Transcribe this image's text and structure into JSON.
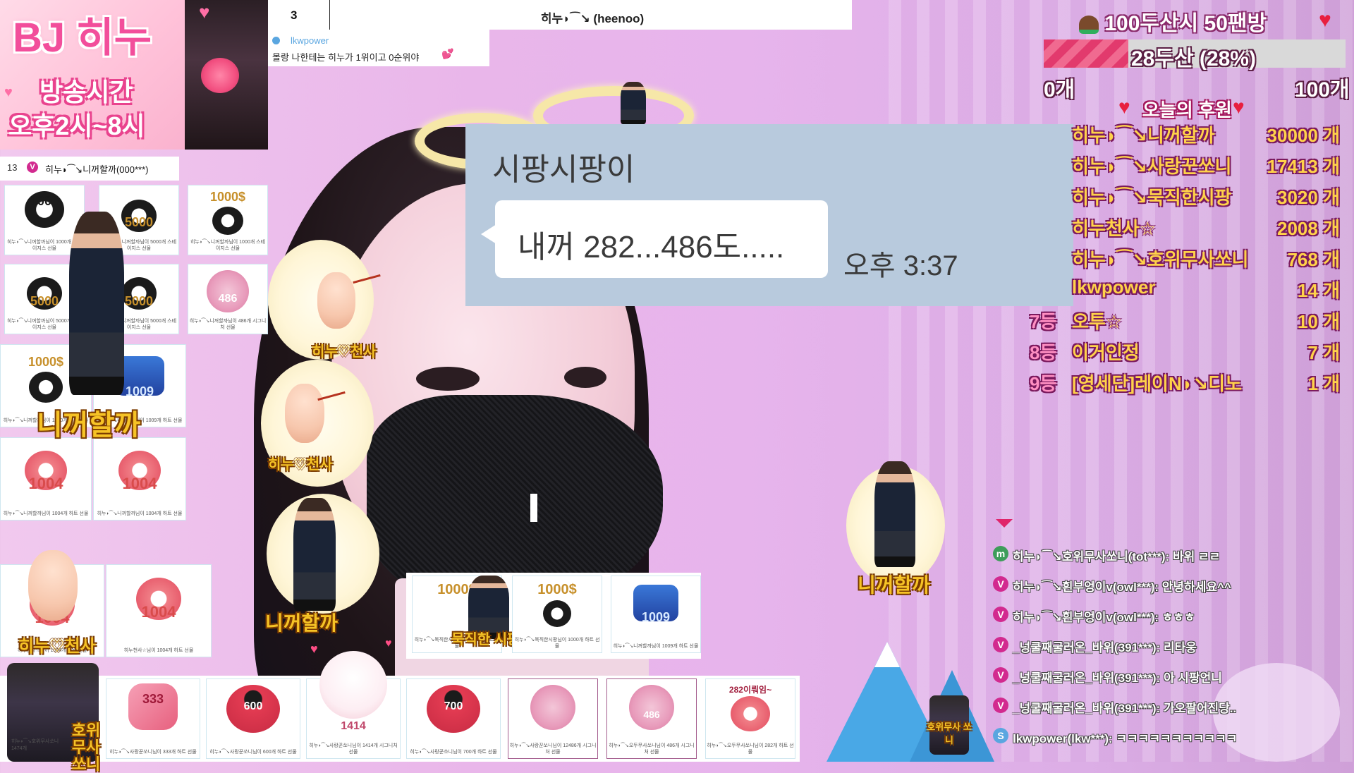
{
  "banner": {
    "title": "BJ 히누",
    "line1": "방송시간",
    "line2": "오후2시~8시"
  },
  "header": {
    "rank": "3",
    "title": "히누◗⁀↘ (heenoo)"
  },
  "chat_note": {
    "user": "lkwpower",
    "message": "몰랑 나한테는 히누가 1위이고 0순위야"
  },
  "donation_list": {
    "rank": "13",
    "badge": "V",
    "user": "히누◗⁀↘니꺼할까(000***)"
  },
  "cards": {
    "c1": {
      "num": "1000",
      "label": "히누◗⁀↘니꺼할까님이 1000개 스테이지스 선물"
    },
    "c2": {
      "num": "5000",
      "label": "히누◗⁀↘니꺼할까님이 5000개 스테이지스 선물"
    },
    "c3": {
      "num": "1000$",
      "label": "히누◗⁀↘니꺼할까님이 1000개 스테이지스 선물"
    },
    "c4": {
      "num": "5000",
      "label": "히누◗⁀↘니꺼할까님이 5000개 스테이지스 선물"
    },
    "c5": {
      "num": "5000",
      "label": "히누◗⁀↘니꺼할까님이 5000개 스테이지스 선물"
    },
    "c6": {
      "num": "486",
      "label": "히누◗⁀↘니꺼할까님이 486개 시그니처 선물"
    },
    "c7": {
      "num": "1000$",
      "label": "히누◗⁀↘니꺼할까님이 1000개 하트 선물"
    },
    "c8": {
      "num": "1009",
      "label": "히누◗⁀↘니꺼할까님이 1009개 하트 선물"
    },
    "c9": {
      "num": "1004",
      "label": "히누◗⁀↘니꺼할까님이 1004개 하트 선물"
    },
    "c10": {
      "num": "1004",
      "label": "히누◗⁀↘니꺼할까님이 1004개 하트 선물"
    },
    "c11": {
      "num": "1004",
      "label": "히누천사☆님이 1004개 하트 선물"
    },
    "c12": {
      "num": "1004",
      "label": "히누천사☆님이 1004개 하트 선물"
    },
    "m1": {
      "num": "1000$",
      "label": "히누◗⁀↘목직한시팡님이 1000개 하트 선물"
    },
    "m2": {
      "num": "1000$",
      "label": "히누◗⁀↘목직한시팡님이 1000개 하트 선물"
    },
    "m3": {
      "num": "1009",
      "label": "히누◗⁀↘니꺼할까님이 1009개 하트 선물"
    },
    "b1": {
      "num": "1474",
      "label": "히누◗⁀↘호위무사쏘니 1474개"
    },
    "b2": {
      "num": "333",
      "label": "히누◗⁀↘사랑꾼쏘니님이 333개 하트 선물"
    },
    "b3": {
      "num": "600",
      "label": "히누◗⁀↘사랑꾼쏘니님이 600개 하트 선물"
    },
    "b4": {
      "num": "1414",
      "label": "히누◗⁀↘사랑꾼쏘니님이 1414개 시그니처 선물"
    },
    "b5": {
      "num": "700",
      "label": "히누◗⁀↘사랑꾼쏘니님이 700개 하트 선물"
    },
    "b6": {
      "num": "12486",
      "label": "히누◗⁀↘사랑꾼쏘니님이 12486개 시그니처 선물"
    },
    "b7": {
      "num": "486",
      "label": "히누◗⁀↘오두무사쏘니님이 486개 시그니처 선물"
    },
    "b8": {
      "num": "282",
      "label": "히누◗⁀↘오두무사쏘니님이 282개 하트 선물"
    }
  },
  "sticker_labels": {
    "nikkeo": "니꺼할까",
    "angel": "히누♡천사",
    "guard": "호위무사 쏘니",
    "buddy": "282이뤄임~"
  },
  "popup": {
    "sender": "시팡시팡이",
    "message": "내꺼 282...486도.....",
    "time": "오후 3:37"
  },
  "goal": {
    "title": "100두산시 50팬방",
    "progress_text": "28두산 (28%)",
    "progress_fraction": 0.28,
    "min": "0개",
    "max": "100개",
    "accent": "#e23a6d"
  },
  "ranking": {
    "title": "오늘의 후원",
    "rows": [
      {
        "pos": "",
        "name": "히누◗⁀↘니꺼할까",
        "count": "30000 개"
      },
      {
        "pos": "",
        "name": "히누◗⁀↘사랑꾼쏘니",
        "count": "17413 개"
      },
      {
        "pos": "",
        "name": "히누◗⁀↘묵직한시팡",
        "count": "3020 개"
      },
      {
        "pos": "",
        "name": "히누천사☆",
        "count": "2008 개"
      },
      {
        "pos": "",
        "name": "히누◗⁀↘호위무사쏘니",
        "count": "768 개"
      },
      {
        "pos": "",
        "name": "lkwpower",
        "count": "14 개"
      },
      {
        "pos": "7등",
        "name": "오투☆",
        "count": "10 개"
      },
      {
        "pos": "8등",
        "name": "이거인정",
        "count": "7 개"
      },
      {
        "pos": "9등",
        "name": "[영세단]레이N◗↘디노",
        "count": "1 개"
      }
    ]
  },
  "chat": {
    "rows": [
      {
        "badge": "m",
        "text": "히누◗⁀↘호위무사쏘니(tot***): 바위 ㄹㄹ"
      },
      {
        "badge": "V",
        "text": "히누◗⁀↘흰부엉이v(owl***): 안녕하세요^^"
      },
      {
        "badge": "V",
        "text": "히누◗⁀↘흰부엉이v(owl***): ㅎㅎㅎ"
      },
      {
        "badge": "V",
        "text": "_넝쿨째굴러온_바위(391***): 리타웅"
      },
      {
        "badge": "V",
        "text": "_넝쿨째굴러온_바위(391***): 아 시팡언니"
      },
      {
        "badge": "V",
        "text": "_넝쿨째굴러온_바위(391***): 가오팔어진당.."
      },
      {
        "badge": "S",
        "text": "lkwpower(lkw***): ㅋㅋㅋㅋㅋㅋㅋㅋㅋㅋㅋ"
      }
    ]
  },
  "colors": {
    "badge_v": "#d22a8f",
    "badge_m": "#3e9d5a",
    "badge_s": "#5aa6e0"
  }
}
